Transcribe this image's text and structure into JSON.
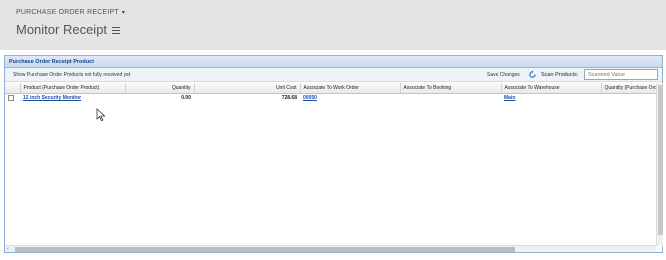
{
  "header": {
    "breadcrumb": "PURCHASE ORDER RECEIPT",
    "breadcrumb_caret": "▾",
    "title": "Monitor Receipt"
  },
  "panel": {
    "title": "Purchase Order Receipt Product",
    "filter_text": "Show Purchase Order Products not fully received yet",
    "save_changes": "Save Changes",
    "scan_label": "Scan Products:",
    "scan_placeholder": "Scanned Value"
  },
  "grid": {
    "columns": [
      "",
      "Product (Purchase Order Product)",
      "Quantity",
      "Unit Cost",
      "Associate To Work Order",
      "Associate To Booking",
      "Associate To Warehouse",
      "Quantity (Purchase Order Prod"
    ],
    "rows": [
      {
        "product": "12 inch Security Monitor",
        "quantity": "0.00",
        "unit_cost": "728.68",
        "work_order": "00050",
        "booking": "",
        "warehouse": "Main",
        "po_quantity": ""
      }
    ]
  },
  "icons": {
    "refresh": "refresh-icon",
    "menu": "hamburger-icon",
    "cursor": "mouse-pointer-icon"
  },
  "colors": {
    "header_bg": "#e4e4e4",
    "panel_border": "#8fb0d8",
    "panel_title": "#15428b",
    "link": "#1a4fa6"
  }
}
